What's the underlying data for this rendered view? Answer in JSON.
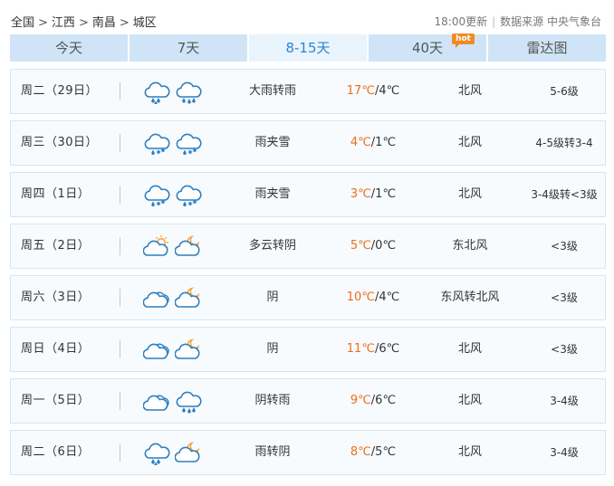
{
  "breadcrumb": {
    "items": [
      "全国",
      "江西",
      "南昌",
      "城区"
    ],
    "separator": ">"
  },
  "meta": {
    "update_time": "18:00更新",
    "source": "数据来源 中央气象台"
  },
  "tabs": [
    {
      "label": "今天",
      "active": false
    },
    {
      "label": "7天",
      "active": false
    },
    {
      "label": "8-15天",
      "active": true
    },
    {
      "label": "40天",
      "active": false,
      "badge": "hot"
    },
    {
      "label": "雷达图",
      "active": false
    }
  ],
  "days": [
    {
      "date": "周二（29日）",
      "icons": [
        "heavy-rain-icon",
        "rain-icon"
      ],
      "weather": "大雨转雨",
      "high": "17℃",
      "low": "/4℃",
      "wind_dir": "北风",
      "wind_level": "5-6级"
    },
    {
      "date": "周三（30日）",
      "icons": [
        "sleet-icon",
        "sleet-icon"
      ],
      "weather": "雨夹雪",
      "high": "4℃",
      "low": "/1℃",
      "wind_dir": "北风",
      "wind_level": "4-5级转3-4"
    },
    {
      "date": "周四（1日）",
      "icons": [
        "sleet-icon",
        "sleet-icon"
      ],
      "weather": "雨夹雪",
      "high": "3℃",
      "low": "/1℃",
      "wind_dir": "北风",
      "wind_level": "3-4级转<3级"
    },
    {
      "date": "周五（2日）",
      "icons": [
        "partly-cloudy-icon",
        "night-cloudy-icon"
      ],
      "weather": "多云转阴",
      "high": "5℃",
      "low": "/0℃",
      "wind_dir": "东北风",
      "wind_level": "<3级"
    },
    {
      "date": "周六（3日）",
      "icons": [
        "overcast-icon",
        "night-cloudy-icon"
      ],
      "weather": "阴",
      "high": "10℃",
      "low": "/4℃",
      "wind_dir": "东风转北风",
      "wind_level": "<3级"
    },
    {
      "date": "周日（4日）",
      "icons": [
        "overcast-icon",
        "night-cloudy-icon"
      ],
      "weather": "阴",
      "high": "11℃",
      "low": "/6℃",
      "wind_dir": "北风",
      "wind_level": "<3级"
    },
    {
      "date": "周一（5日）",
      "icons": [
        "overcast-icon",
        "rain-icon"
      ],
      "weather": "阴转雨",
      "high": "9℃",
      "low": "/6℃",
      "wind_dir": "北风",
      "wind_level": "3-4级"
    },
    {
      "date": "周二（6日）",
      "icons": [
        "heavy-rain-icon",
        "night-cloudy-icon"
      ],
      "weather": "雨转阴",
      "high": "8℃",
      "low": "/5℃",
      "wind_dir": "北风",
      "wind_level": "3-4级"
    }
  ],
  "colors": {
    "accent": "#2a86d1",
    "tab_bg": "#cfe5f7",
    "tab_active_bg": "#e9f4fd",
    "temp_high": "#f06d19",
    "icon_stroke": "#2d7fc0",
    "hot_badge": "#f08a24"
  }
}
